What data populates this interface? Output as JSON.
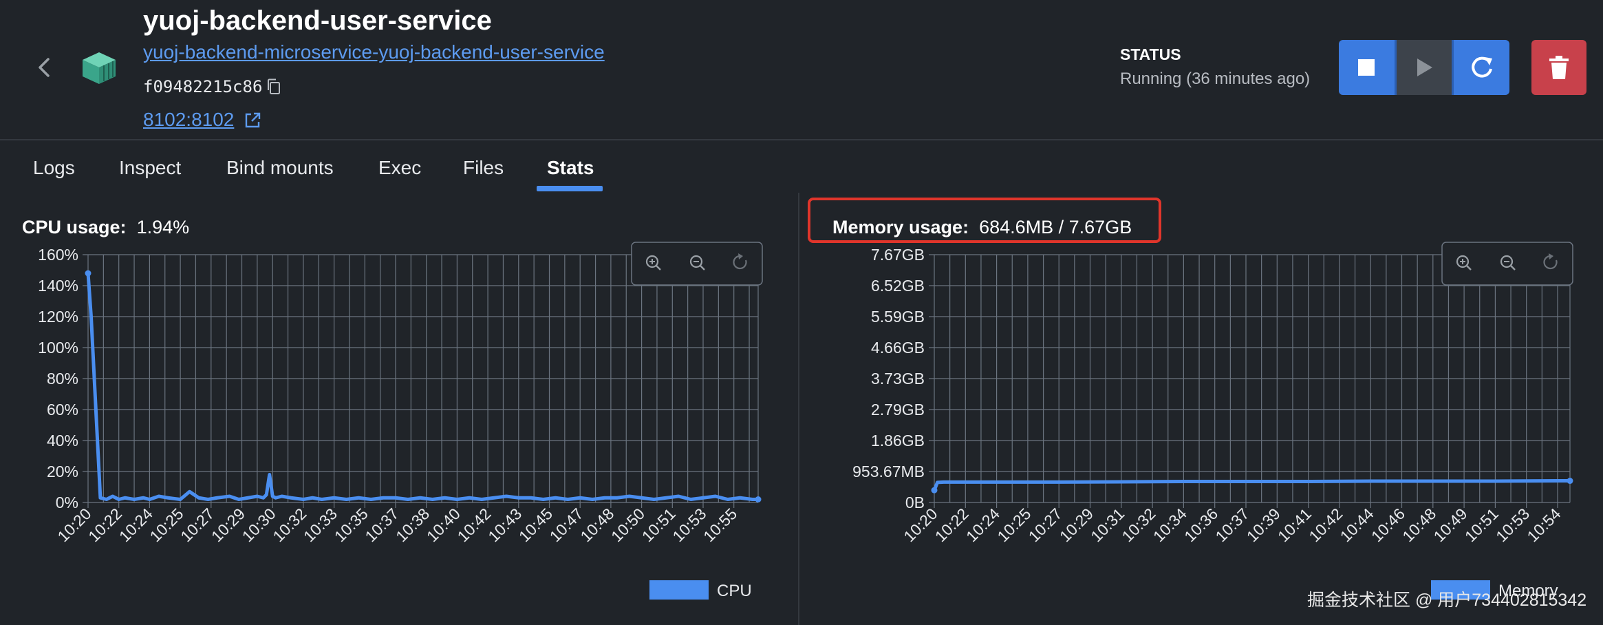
{
  "header": {
    "title": "yuoj-backend-user-service",
    "subtitle": "yuoj-backend-microservice-yuoj-backend-user-service",
    "container_id": "f09482215c86",
    "port": "8102:8102"
  },
  "status": {
    "label": "STATUS",
    "value": "Running (36 minutes ago)"
  },
  "tabs": [
    {
      "label": "Logs"
    },
    {
      "label": "Inspect"
    },
    {
      "label": "Bind mounts"
    },
    {
      "label": "Exec"
    },
    {
      "label": "Files"
    },
    {
      "label": "Stats",
      "active": true
    }
  ],
  "cpu": {
    "label": "CPU usage:",
    "value": "1.94%"
  },
  "memory": {
    "label": "Memory usage:",
    "value": "684.6MB / 7.67GB"
  },
  "colors": {
    "accent": "#3b7be0",
    "line": "#4a8ef0",
    "delete": "#c8414b",
    "highlight": "#e0352b"
  },
  "chart_data": [
    {
      "type": "line",
      "title": "CPU usage",
      "y_ticks": [
        "0%",
        "20%",
        "40%",
        "60%",
        "80%",
        "100%",
        "120%",
        "140%",
        "160%"
      ],
      "ylim": [
        0,
        160
      ],
      "x_ticks": [
        "10:20",
        "10:22",
        "10:24",
        "10:25",
        "10:27",
        "10:29",
        "10:30",
        "10:32",
        "10:33",
        "10:35",
        "10:37",
        "10:38",
        "10:40",
        "10:42",
        "10:43",
        "10:45",
        "10:47",
        "10:48",
        "10:50",
        "10:51",
        "10:53",
        "10:55"
      ],
      "series": [
        {
          "name": "CPU",
          "x": [
            0,
            0.1,
            0.4,
            0.6,
            0.8,
            1,
            1.2,
            1.5,
            1.8,
            2,
            2.3,
            2.6,
            3,
            3.3,
            3.6,
            3.9,
            4.2,
            4.6,
            4.9,
            5.2,
            5.5,
            5.7,
            5.8,
            5.9,
            6,
            6.1,
            6.3,
            6.6,
            7,
            7.3,
            7.6,
            8,
            8.4,
            8.8,
            9.2,
            9.6,
            10,
            10.4,
            10.8,
            11.2,
            11.6,
            12,
            12.4,
            12.8,
            13.2,
            13.6,
            14,
            14.4,
            14.8,
            15.2,
            15.6,
            16,
            16.4,
            16.8,
            17.2,
            17.6,
            18,
            18.4,
            18.8,
            19.2,
            19.6,
            20,
            20.4,
            20.8,
            21.2,
            21.6,
            21.9
          ],
          "values": [
            148,
            120,
            3,
            2,
            4,
            2,
            3,
            2,
            3,
            2,
            4,
            3,
            2,
            7,
            3,
            2,
            3,
            4,
            2,
            3,
            4,
            3,
            5,
            18,
            4,
            3,
            4,
            3,
            2,
            3,
            2,
            3,
            2,
            3,
            2,
            3,
            3,
            2,
            3,
            2,
            3,
            2,
            3,
            2,
            3,
            4,
            3,
            3,
            2,
            3,
            2,
            3,
            2,
            3,
            3,
            4,
            3,
            2,
            3,
            4,
            2,
            3,
            4,
            2,
            3,
            2,
            2
          ]
        }
      ],
      "legend": "bottom-right",
      "grid": true
    },
    {
      "type": "line",
      "title": "Memory usage",
      "y_ticks": [
        "0B",
        "953.67MB",
        "1.86GB",
        "2.79GB",
        "3.73GB",
        "4.66GB",
        "5.59GB",
        "6.52GB",
        "7.67GB"
      ],
      "ylim": [
        0,
        7.67
      ],
      "x_ticks": [
        "10:20",
        "10:22",
        "10:24",
        "10:25",
        "10:27",
        "10:29",
        "10:31",
        "10:32",
        "10:34",
        "10:36",
        "10:37",
        "10:39",
        "10:41",
        "10:42",
        "10:44",
        "10:46",
        "10:48",
        "10:49",
        "10:51",
        "10:53",
        "10:54"
      ],
      "series": [
        {
          "name": "Memory",
          "x": [
            0,
            0.1,
            0.3,
            2,
            4,
            6,
            8,
            10,
            12,
            14,
            16,
            18,
            20,
            21.9
          ],
          "values": [
            0.38,
            0.62,
            0.63,
            0.63,
            0.63,
            0.64,
            0.65,
            0.65,
            0.65,
            0.66,
            0.66,
            0.66,
            0.67,
            0.67
          ]
        }
      ],
      "legend": "bottom-right",
      "grid": true
    }
  ],
  "watermark": "掘金技术社区 @ 用户734402815342"
}
